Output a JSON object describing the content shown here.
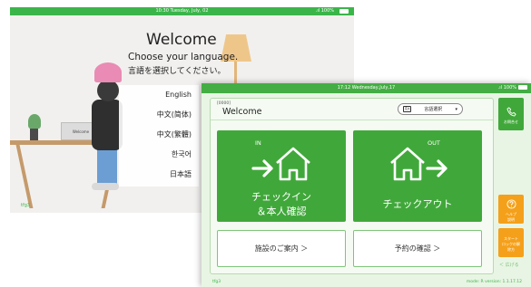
{
  "back_screen": {
    "status_time": "10:30 Tuesday, July, 02",
    "status_battery": "100%",
    "welcome_title": "Welcome",
    "choose_language_en": "Choose your language.",
    "choose_language_ja": "言語を選択してください。",
    "laptop_text": "Welcome",
    "languages": [
      "English",
      "中文(简体)",
      "中文(繁體)",
      "한국어",
      "日本語"
    ],
    "footer_left": "tfg3"
  },
  "front_screen": {
    "status_time": "17:12 Wednesday,July,17",
    "status_battery": "100%",
    "code": "[0000]",
    "welcome_title": "Welcome",
    "language_select_label": "言語選択",
    "checkin": {
      "tag": "IN",
      "line1": "チェックイン",
      "line2": "＆本人確認"
    },
    "checkout": {
      "tag": "OUT",
      "label": "チェックアウト"
    },
    "facility_guide": "施設のご案内 ＞",
    "reservation_check": "予約の確認 ＞",
    "sidebar": {
      "contact": "お問合せ",
      "help_line1": "ヘルプ",
      "help_line2": "説明",
      "start_line1": "スタート",
      "start_line2": "ロックの解",
      "start_line3": "除方",
      "collapse": "＜ 広げる"
    },
    "footer_left": "tfg3",
    "footer_right": "mode: R  version: 1.1.17.12"
  },
  "colors": {
    "brand_green": "#40a83a",
    "status_green": "#44ad44",
    "accent_orange": "#f5a01a",
    "panel_bg": "#e8f5e4"
  }
}
